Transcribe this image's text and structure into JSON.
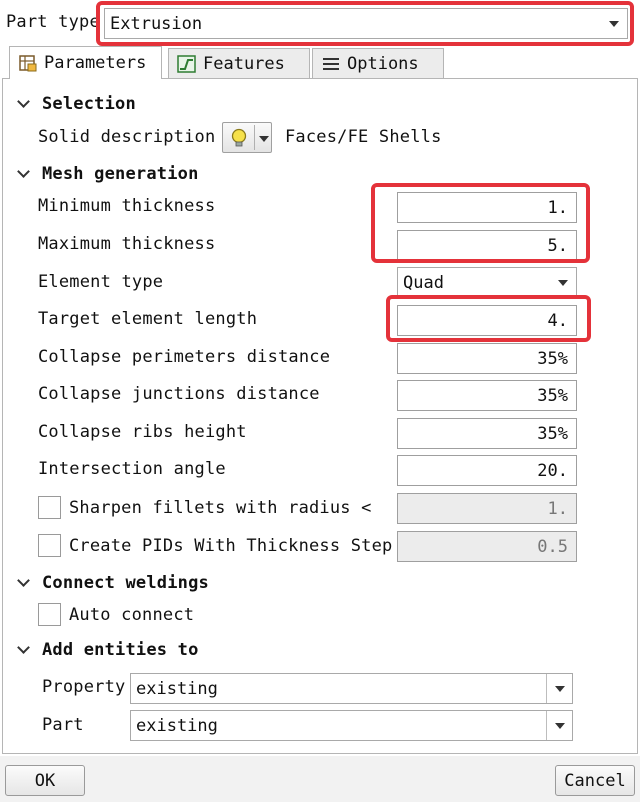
{
  "part_type": {
    "label": "Part type",
    "value": "Extrusion"
  },
  "tabs": [
    {
      "label": "Parameters",
      "icon": "parameters-icon"
    },
    {
      "label": "Features",
      "icon": "features-icon"
    },
    {
      "label": "Options",
      "icon": "options-icon"
    }
  ],
  "selection": {
    "header": "Selection",
    "solid_label": "Solid description",
    "solid_value": "Faces/FE Shells"
  },
  "mesh": {
    "header": "Mesh generation",
    "min_thickness": {
      "label": "Minimum thickness",
      "value": "1."
    },
    "max_thickness": {
      "label": "Maximum thickness",
      "value": "5."
    },
    "element_type": {
      "label": "Element type",
      "value": "Quad"
    },
    "target_length": {
      "label": "Target element length",
      "value": "4."
    },
    "collapse_perimeters": {
      "label": "Collapse perimeters distance",
      "value": "35%"
    },
    "collapse_junctions": {
      "label": "Collapse junctions distance",
      "value": "35%"
    },
    "collapse_ribs": {
      "label": "Collapse ribs height",
      "value": "35%"
    },
    "intersection_angle": {
      "label": "Intersection angle",
      "value": "20."
    },
    "sharpen_fillets": {
      "label": "Sharpen fillets with radius <",
      "value": "1.",
      "checked": false
    },
    "create_pids": {
      "label": "Create PIDs With Thickness Step",
      "value": "0.5",
      "checked": false
    }
  },
  "weldings": {
    "header": "Connect weldings",
    "auto_connect": {
      "label": "Auto connect",
      "checked": false
    }
  },
  "add_entities": {
    "header": "Add entities to",
    "property": {
      "label": "Property",
      "value": "existing"
    },
    "part": {
      "label": "Part",
      "value": "existing"
    }
  },
  "buttons": {
    "ok": "OK",
    "cancel": "Cancel"
  },
  "colors": {
    "highlight": "#e4323a",
    "panel_border": "#b5b5b5"
  }
}
